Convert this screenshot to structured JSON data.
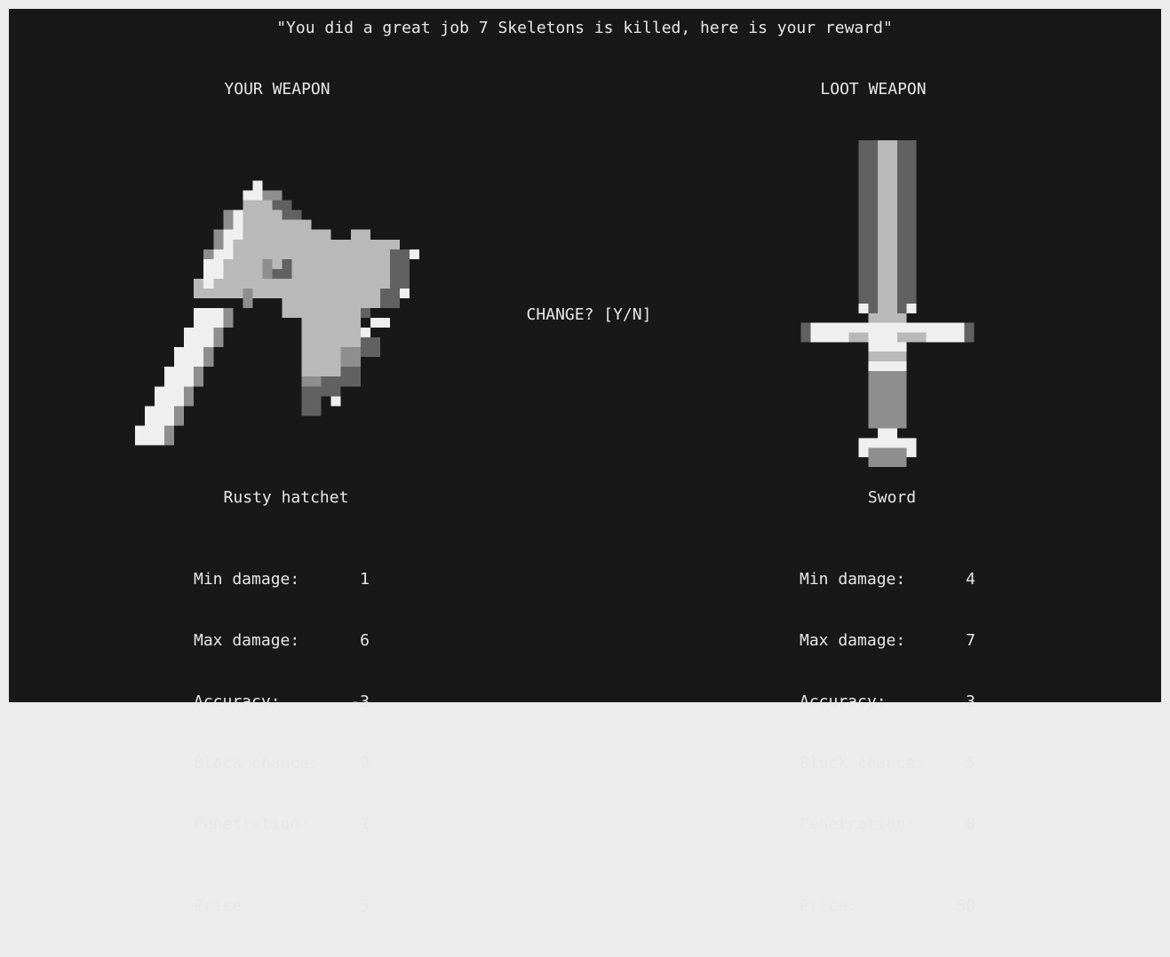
{
  "message": "\"You did a great job 7 Skeletons is killed, here is your reward\"",
  "prompt": "CHANGE? [Y/N]",
  "colors": {
    "background": "#181818",
    "frame": "#ececec",
    "text": "#e8e8e8"
  },
  "your_weapon": {
    "heading": "YOUR WEAPON",
    "icon": "hatchet-icon",
    "name": "Rusty hatchet",
    "stats": [
      {
        "label": "Min damage:",
        "value": "1"
      },
      {
        "label": "Max damage:",
        "value": "6"
      },
      {
        "label": "Accuracy:",
        "value": "-3"
      },
      {
        "label": "Block chance:",
        "value": "0"
      },
      {
        "label": "Penetration:",
        "value": "1"
      }
    ],
    "price_label": "Price:",
    "price": "5"
  },
  "loot_weapon": {
    "heading": "LOOT WEAPON",
    "icon": "sword-icon",
    "name": "Sword",
    "stats": [
      {
        "label": "Min damage:",
        "value": "4"
      },
      {
        "label": "Max damage:",
        "value": "7"
      },
      {
        "label": "Accuracy:",
        "value": "3"
      },
      {
        "label": "Block chance:",
        "value": "5"
      },
      {
        "label": "Penetration:",
        "value": "0"
      }
    ],
    "price_label": "Price:",
    "price": "50"
  }
}
